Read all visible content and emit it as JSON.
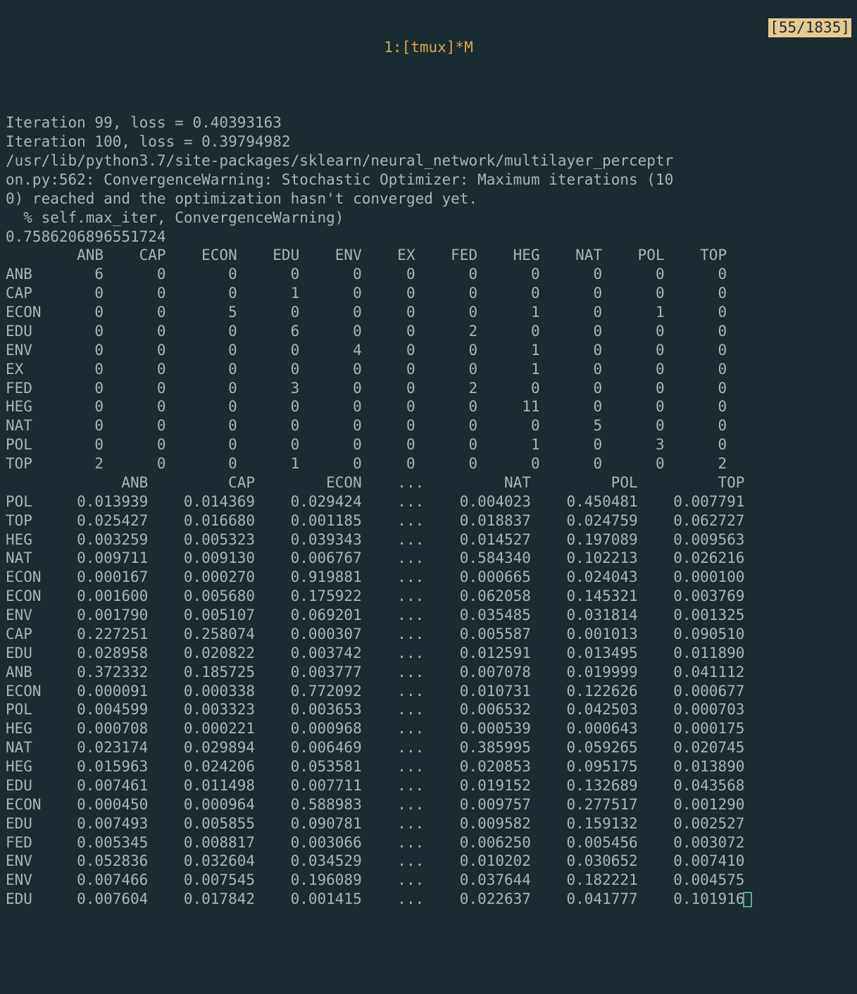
{
  "title": "1:[tmux]*M",
  "search_indicator": "[55/1835]",
  "pre_lines": [
    "Iteration 99, loss = 0.40393163",
    "Iteration 100, loss = 0.39794982",
    "/usr/lib/python3.7/site-packages/sklearn/neural_network/multilayer_perceptr",
    "on.py:562: ConvergenceWarning: Stochastic Optimizer: Maximum iterations (10",
    "0) reached and the optimization hasn't converged yet.",
    "  % self.max_iter, ConvergenceWarning)",
    "0.7586206896551724"
  ],
  "labels": [
    "ANB",
    "CAP",
    "ECON",
    "EDU",
    "ENV",
    "EX",
    "FED",
    "HEG",
    "NAT",
    "POL",
    "TOP"
  ],
  "confusion": {
    "headers": [
      "ANB",
      "CAP",
      "ECON",
      "EDU",
      "ENV",
      "EX",
      "FED",
      "HEG",
      "NAT",
      "POL",
      "TOP"
    ],
    "rows": [
      {
        "label": "ANB",
        "vals": [
          6,
          0,
          0,
          0,
          0,
          0,
          0,
          0,
          0,
          0,
          0
        ]
      },
      {
        "label": "CAP",
        "vals": [
          0,
          0,
          0,
          1,
          0,
          0,
          0,
          0,
          0,
          0,
          0
        ]
      },
      {
        "label": "ECON",
        "vals": [
          0,
          0,
          5,
          0,
          0,
          0,
          0,
          1,
          0,
          1,
          0
        ]
      },
      {
        "label": "EDU",
        "vals": [
          0,
          0,
          0,
          6,
          0,
          0,
          2,
          0,
          0,
          0,
          0
        ]
      },
      {
        "label": "ENV",
        "vals": [
          0,
          0,
          0,
          0,
          4,
          0,
          0,
          1,
          0,
          0,
          0
        ]
      },
      {
        "label": "EX",
        "vals": [
          0,
          0,
          0,
          0,
          0,
          0,
          0,
          1,
          0,
          0,
          0
        ]
      },
      {
        "label": "FED",
        "vals": [
          0,
          0,
          0,
          3,
          0,
          0,
          2,
          0,
          0,
          0,
          0
        ]
      },
      {
        "label": "HEG",
        "vals": [
          0,
          0,
          0,
          0,
          0,
          0,
          0,
          11,
          0,
          0,
          0
        ]
      },
      {
        "label": "NAT",
        "vals": [
          0,
          0,
          0,
          0,
          0,
          0,
          0,
          0,
          5,
          0,
          0
        ]
      },
      {
        "label": "POL",
        "vals": [
          0,
          0,
          0,
          0,
          0,
          0,
          0,
          1,
          0,
          3,
          0
        ]
      },
      {
        "label": "TOP",
        "vals": [
          2,
          0,
          0,
          1,
          0,
          0,
          0,
          0,
          0,
          0,
          2
        ]
      }
    ]
  },
  "probs": {
    "headers": [
      "ANB",
      "CAP",
      "ECON",
      "...",
      "NAT",
      "POL",
      "TOP"
    ],
    "rows": [
      {
        "label": "POL",
        "vals": [
          "0.013939",
          "0.014369",
          "0.029424",
          "...",
          "0.004023",
          "0.450481",
          "0.007791"
        ]
      },
      {
        "label": "TOP",
        "vals": [
          "0.025427",
          "0.016680",
          "0.001185",
          "...",
          "0.018837",
          "0.024759",
          "0.062727"
        ]
      },
      {
        "label": "HEG",
        "vals": [
          "0.003259",
          "0.005323",
          "0.039343",
          "...",
          "0.014527",
          "0.197089",
          "0.009563"
        ]
      },
      {
        "label": "NAT",
        "vals": [
          "0.009711",
          "0.009130",
          "0.006767",
          "...",
          "0.584340",
          "0.102213",
          "0.026216"
        ]
      },
      {
        "label": "ECON",
        "vals": [
          "0.000167",
          "0.000270",
          "0.919881",
          "...",
          "0.000665",
          "0.024043",
          "0.000100"
        ]
      },
      {
        "label": "ECON",
        "vals": [
          "0.001600",
          "0.005680",
          "0.175922",
          "...",
          "0.062058",
          "0.145321",
          "0.003769"
        ]
      },
      {
        "label": "ENV",
        "vals": [
          "0.001790",
          "0.005107",
          "0.069201",
          "...",
          "0.035485",
          "0.031814",
          "0.001325"
        ]
      },
      {
        "label": "CAP",
        "vals": [
          "0.227251",
          "0.258074",
          "0.000307",
          "...",
          "0.005587",
          "0.001013",
          "0.090510"
        ]
      },
      {
        "label": "EDU",
        "vals": [
          "0.028958",
          "0.020822",
          "0.003742",
          "...",
          "0.012591",
          "0.013495",
          "0.011890"
        ]
      },
      {
        "label": "ANB",
        "vals": [
          "0.372332",
          "0.185725",
          "0.003777",
          "...",
          "0.007078",
          "0.019999",
          "0.041112"
        ]
      },
      {
        "label": "ECON",
        "vals": [
          "0.000091",
          "0.000338",
          "0.772092",
          "...",
          "0.010731",
          "0.122626",
          "0.000677"
        ]
      },
      {
        "label": "POL",
        "vals": [
          "0.004599",
          "0.003323",
          "0.003653",
          "...",
          "0.006532",
          "0.042503",
          "0.000703"
        ]
      },
      {
        "label": "HEG",
        "vals": [
          "0.000708",
          "0.000221",
          "0.000968",
          "...",
          "0.000539",
          "0.000643",
          "0.000175"
        ]
      },
      {
        "label": "NAT",
        "vals": [
          "0.023174",
          "0.029894",
          "0.006469",
          "...",
          "0.385995",
          "0.059265",
          "0.020745"
        ]
      },
      {
        "label": "HEG",
        "vals": [
          "0.015963",
          "0.024206",
          "0.053581",
          "...",
          "0.020853",
          "0.095175",
          "0.013890"
        ]
      },
      {
        "label": "EDU",
        "vals": [
          "0.007461",
          "0.011498",
          "0.007711",
          "...",
          "0.019152",
          "0.132689",
          "0.043568"
        ]
      },
      {
        "label": "ECON",
        "vals": [
          "0.000450",
          "0.000964",
          "0.588983",
          "...",
          "0.009757",
          "0.277517",
          "0.001290"
        ]
      },
      {
        "label": "EDU",
        "vals": [
          "0.007493",
          "0.005855",
          "0.090781",
          "...",
          "0.009582",
          "0.159132",
          "0.002527"
        ]
      },
      {
        "label": "FED",
        "vals": [
          "0.005345",
          "0.008817",
          "0.003066",
          "...",
          "0.006250",
          "0.005456",
          "0.003072"
        ]
      },
      {
        "label": "ENV",
        "vals": [
          "0.052836",
          "0.032604",
          "0.034529",
          "...",
          "0.010202",
          "0.030652",
          "0.007410"
        ]
      },
      {
        "label": "ENV",
        "vals": [
          "0.007466",
          "0.007545",
          "0.196089",
          "...",
          "0.037644",
          "0.182221",
          "0.004575"
        ]
      },
      {
        "label": "EDU",
        "vals": [
          "0.007604",
          "0.017842",
          "0.001415",
          "...",
          "0.022637",
          "0.041777",
          "0.101916"
        ]
      }
    ]
  }
}
